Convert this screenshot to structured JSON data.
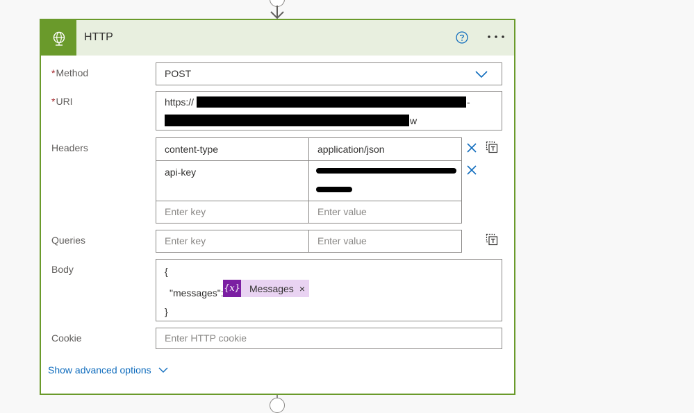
{
  "action": {
    "title": "HTTP",
    "help_icon": "question-circle-icon",
    "more_icon": "more-horizontal-icon"
  },
  "colors": {
    "accent": "#6a9a2b",
    "header_bg": "#e8efdf",
    "link": "#0f6cbd",
    "required": "#a4262c",
    "token_bg": "#e9d3f2",
    "token_icon_bg": "#7b1fa2"
  },
  "fields": {
    "method": {
      "label": "Method",
      "required_mark": "*",
      "value": "POST"
    },
    "uri": {
      "label": "URI",
      "required_mark": "*",
      "value_prefix": "https://",
      "value_tail_line1": "-",
      "value_tail_line2": "w"
    },
    "headers": {
      "label": "Headers",
      "rows": [
        {
          "key": "content-type",
          "value": "application/json"
        },
        {
          "key": "api-key",
          "value": ""
        }
      ],
      "key_placeholder": "Enter key",
      "value_placeholder": "Enter value"
    },
    "queries": {
      "label": "Queries",
      "key_placeholder": "Enter key",
      "value_placeholder": "Enter value"
    },
    "body": {
      "label": "Body",
      "line1": "{",
      "line2_prefix": "\"messages\":",
      "token_label": "Messages",
      "token_icon_text": "{x}",
      "token_remove": "×",
      "line3": "}"
    },
    "cookie": {
      "label": "Cookie",
      "placeholder": "Enter HTTP cookie"
    }
  },
  "advanced": {
    "label": "Show advanced options"
  }
}
